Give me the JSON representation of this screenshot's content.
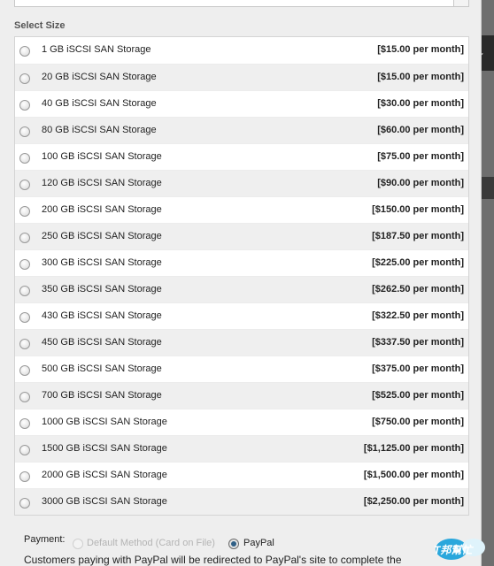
{
  "section_title": "Select Size",
  "sizes": [
    {
      "label": "1 GB iSCSI SAN Storage",
      "price": "[$15.00 per month]"
    },
    {
      "label": "20 GB iSCSI SAN Storage",
      "price": "[$15.00 per month]"
    },
    {
      "label": "40 GB iSCSI SAN Storage",
      "price": "[$30.00 per month]"
    },
    {
      "label": "80 GB iSCSI SAN Storage",
      "price": "[$60.00 per month]"
    },
    {
      "label": "100 GB iSCSI SAN Storage",
      "price": "[$75.00 per month]"
    },
    {
      "label": "120 GB iSCSI SAN Storage",
      "price": "[$90.00 per month]"
    },
    {
      "label": "200 GB iSCSI SAN Storage",
      "price": "[$150.00 per month]"
    },
    {
      "label": "250 GB iSCSI SAN Storage",
      "price": "[$187.50 per month]"
    },
    {
      "label": "300 GB iSCSI SAN Storage",
      "price": "[$225.00 per month]"
    },
    {
      "label": "350 GB iSCSI SAN Storage",
      "price": "[$262.50 per month]"
    },
    {
      "label": "430 GB iSCSI SAN Storage",
      "price": "[$322.50 per month]"
    },
    {
      "label": "450 GB iSCSI SAN Storage",
      "price": "[$337.50 per month]"
    },
    {
      "label": "500 GB iSCSI SAN Storage",
      "price": "[$375.00 per month]"
    },
    {
      "label": "700 GB iSCSI SAN Storage",
      "price": "[$525.00 per month]"
    },
    {
      "label": "1000 GB iSCSI SAN Storage",
      "price": "[$750.00 per month]"
    },
    {
      "label": "1500 GB iSCSI SAN Storage",
      "price": "[$1,125.00 per month]"
    },
    {
      "label": "2000 GB iSCSI SAN Storage",
      "price": "[$1,500.00 per month]"
    },
    {
      "label": "3000 GB iSCSI SAN Storage",
      "price": "[$2,250.00 per month]"
    }
  ],
  "payment": {
    "label": "Payment:",
    "options": [
      {
        "label": "Default Method (Card on File)",
        "disabled": true,
        "selected": false
      },
      {
        "label": "PayPal",
        "disabled": false,
        "selected": true
      }
    ],
    "note": "Customers paying with PayPal will be redirected to PayPal's site to complete the"
  },
  "watermark": {
    "text": "iT邦幫忙"
  },
  "colors": {
    "selected_radio": "#2f5f86",
    "row_alt": "#efefef",
    "disabled_text": "#b4b4b4"
  }
}
